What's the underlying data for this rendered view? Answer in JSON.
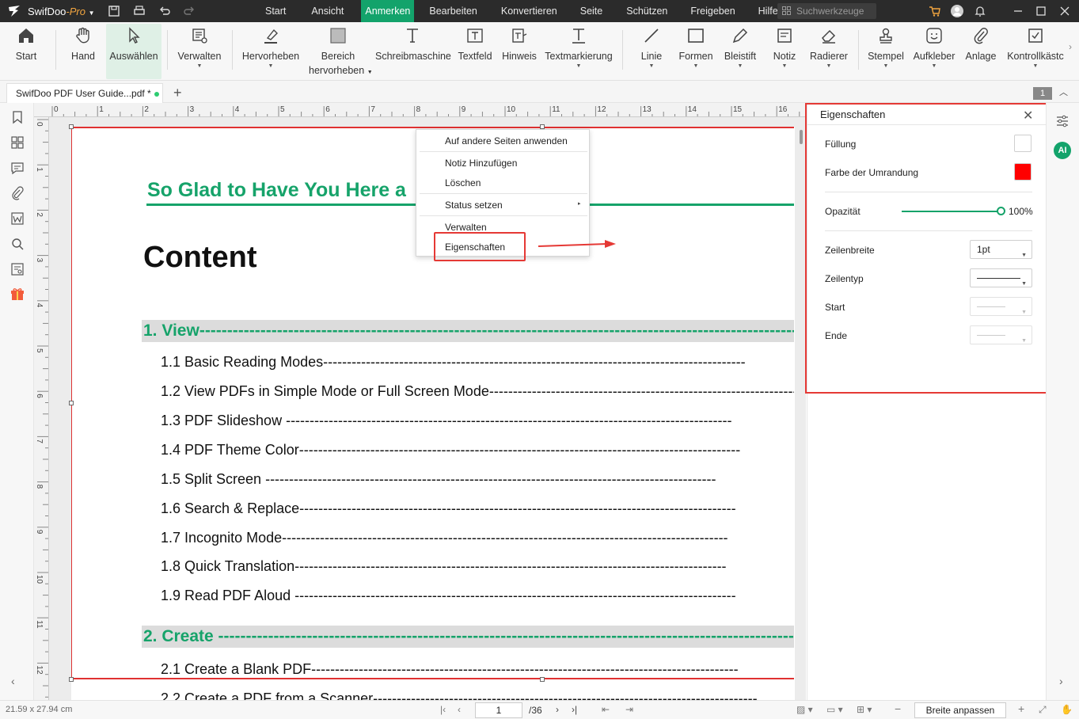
{
  "app": {
    "name": "SwifDoo",
    "pro": "-Pro"
  },
  "menu": [
    "Start",
    "Ansicht",
    "Anmerken",
    "Bearbeiten",
    "Konvertieren",
    "Seite",
    "Schützen",
    "Freigeben",
    "Hilfe"
  ],
  "menu_active": "Anmerken",
  "search_placeholder": "Suchwerkzeuge",
  "ribbon": {
    "start": "Start",
    "hand": "Hand",
    "auswaehlen": "Auswählen",
    "verwalten": "Verwalten",
    "hervorheben": "Hervorheben",
    "bereich1": "Bereich",
    "bereich2": "hervorheben",
    "schreibmaschine": "Schreibmaschine",
    "textfeld": "Textfeld",
    "hinweis": "Hinweis",
    "textmarkierung": "Textmarkierung",
    "linie": "Linie",
    "formen": "Formen",
    "bleistift": "Bleistift",
    "notiz": "Notiz",
    "radierer": "Radierer",
    "stempel": "Stempel",
    "aufkleber": "Aufkleber",
    "anlage": "Anlage",
    "kontrollkaestchen": "Kontrollkästc"
  },
  "tab": {
    "label": "SwifDoo PDF User Guide...pdf *",
    "page_badge": "1"
  },
  "ruler_h": [
    "0",
    "1",
    "2",
    "3",
    "4",
    "5",
    "6",
    "7",
    "8",
    "9",
    "10",
    "11",
    "12",
    "13",
    "14",
    "15",
    "16"
  ],
  "ruler_v": [
    "0",
    "1",
    "2",
    "3",
    "4",
    "5",
    "6",
    "7",
    "8",
    "9",
    "10",
    "11",
    "12"
  ],
  "doc": {
    "title": "So Glad to Have You Here a",
    "content": "Content",
    "sections": [
      {
        "text": "1. View--------------------------------------------------------------------------------------------------------------"
      },
      {
        "text": "2. Create ---------------------------------------------------------------------------------------------------------"
      }
    ],
    "toc": [
      "1.1 Basic Reading Modes-----------------------------------------------------------------------------------------",
      "1.2 View PDFs in Simple Mode or Full Screen Mode-----------------------------------------------------------------",
      "1.3 PDF Slideshow ----------------------------------------------------------------------------------------------",
      "1.4 PDF Theme Color---------------------------------------------------------------------------------------------",
      "1.5 Split Screen -----------------------------------------------------------------------------------------------",
      "1.6 Search & Replace--------------------------------------------------------------------------------------------",
      "1.7 Incognito Mode----------------------------------------------------------------------------------------------",
      "1.8 Quick Translation-------------------------------------------------------------------------------------------",
      "1.9 Read PDF Aloud ---------------------------------------------------------------------------------------------",
      "2.1 Create a Blank PDF------------------------------------------------------------------------------------------",
      "2.2 Create a PDF from a Scanner---------------------------------------------------------------------------------"
    ]
  },
  "context_menu": [
    "Auf andere Seiten anwenden",
    "Notiz Hinzufügen",
    "Löschen",
    "Status setzen",
    "Verwalten",
    "Eigenschaften"
  ],
  "properties": {
    "title": "Eigenschaften",
    "fill_label": "Füllung",
    "border_color_label": "Farbe der Umrandung",
    "border_color": "#ff0000",
    "opacity_label": "Opazität",
    "opacity_value": "100%",
    "opacity": 1.0,
    "line_width_label": "Zeilenbreite",
    "line_width_value": "1pt",
    "line_type_label": "Zeilentyp",
    "start_label": "Start",
    "end_label": "Ende"
  },
  "status": {
    "dimensions": "21.59 x 27.94 cm",
    "page": "1",
    "total": "/36",
    "fit": "Breite anpassen"
  },
  "colors": {
    "accent": "#13a36b",
    "annotation_red": "#e53935"
  }
}
